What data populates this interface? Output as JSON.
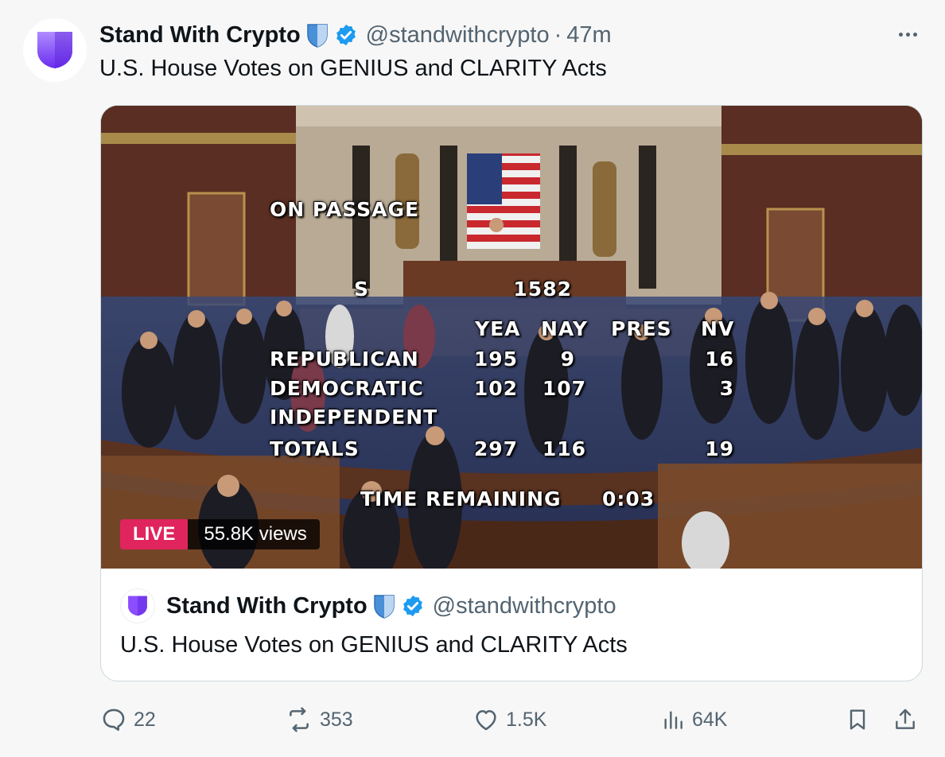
{
  "tweet": {
    "author_name": "Stand With Crypto",
    "handle": "@standwithcrypto",
    "separator": "·",
    "time": "47m",
    "text": "U.S. House Votes on GENIUS and CLARITY Acts"
  },
  "video": {
    "live_label": "LIVE",
    "views_label": "55.8K views",
    "overlay": {
      "title": "ON PASSAGE",
      "bill_letter": "S",
      "bill_number": "1582",
      "columns": [
        "YEA",
        "NAY",
        "PRES",
        "NV"
      ],
      "rows": [
        {
          "party": "REPUBLICAN",
          "yea": "195",
          "nay": "9",
          "pres": "",
          "nv": "16"
        },
        {
          "party": "DEMOCRATIC",
          "yea": "102",
          "nay": "107",
          "pres": "",
          "nv": "3"
        },
        {
          "party": "INDEPENDENT",
          "yea": "",
          "nay": "",
          "pres": "",
          "nv": ""
        },
        {
          "party": "TOTALS",
          "yea": "297",
          "nay": "116",
          "pres": "",
          "nv": "19"
        }
      ],
      "time_label": "TIME REMAINING",
      "time_value": "0:03"
    }
  },
  "quoted": {
    "author_name": "Stand With Crypto",
    "handle": "@standwithcrypto",
    "text": "U.S. House Votes on GENIUS and CLARITY Acts"
  },
  "actions": {
    "replies": "22",
    "reposts": "353",
    "likes": "1.5K",
    "views": "64K"
  },
  "colors": {
    "brand_purple": "#8b4dff",
    "verified_blue": "#1d9bf0",
    "live_red": "#e0245e",
    "muted_text": "#536471"
  },
  "icons": [
    "swc-shield-logo",
    "shield-badge-icon",
    "verified-badge-icon",
    "more-icon",
    "reply-icon",
    "repost-icon",
    "like-icon",
    "views-icon",
    "bookmark-icon",
    "share-icon"
  ]
}
